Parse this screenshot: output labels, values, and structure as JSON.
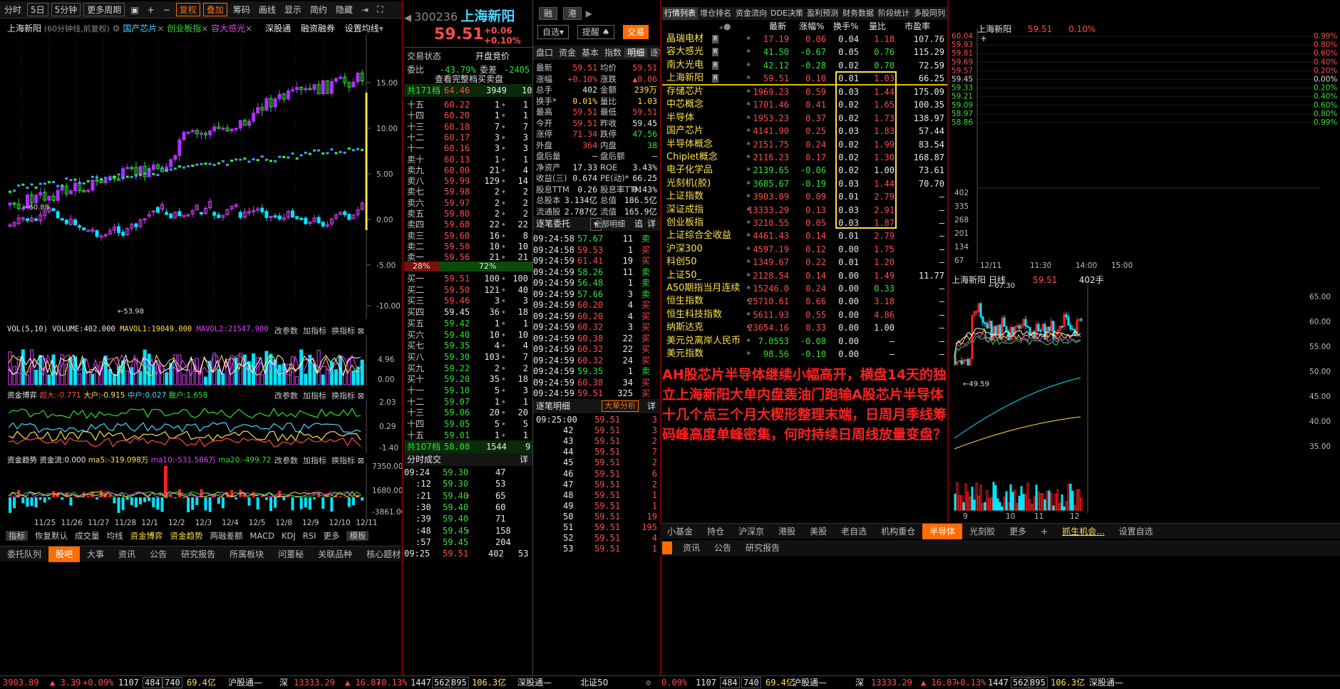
{
  "left_toolbar": [
    "分时",
    "5日",
    "5分钟",
    "更多周期",
    "复权",
    "叠加",
    "筹码",
    "画线",
    "显示",
    "简约",
    "隐藏"
  ],
  "chart_header": {
    "name": "上海新阳",
    "period": "(60分钟线,前复权)",
    "overlays": [
      "国产芯片",
      "创业板指",
      "容大感光"
    ],
    "links": [
      "深股通",
      "融资融券",
      "设置均线"
    ]
  },
  "price_axis": [
    "15.00",
    "10.00",
    "5.00",
    "0.00",
    "-5.00",
    "-10.00"
  ],
  "price_marks": {
    "high": "60.88",
    "low": "53.98"
  },
  "vol_header": {
    "label": "VOL(5,10)",
    "volume": "VOLUME:402.000",
    "mavol1": "MAVOL1:19049.000",
    "mavol2": "MAVOL2:21547.900",
    "buttons": [
      "改参数",
      "加指标",
      "换指标"
    ]
  },
  "vol_axis": [
    "4.96",
    "0.00"
  ],
  "fund_header": {
    "label": "资金博弈",
    "big": "超大:-0.771",
    "large": "大户:-0.915",
    "mid": "中户:0.027",
    "small": "散户:1.658",
    "buttons": [
      "改参数",
      "加指标",
      "换指标"
    ]
  },
  "fund_axis": [
    "2.03",
    "0.29",
    "-1.40"
  ],
  "trend_header": {
    "label": "资金趋势",
    "flow": "资金流:0.000",
    "ma5": "ma5:-319.098万",
    "ma10": "ma10:-531.586万",
    "ma20": "ma20:-499.72",
    "buttons": [
      "改参数",
      "加指标",
      "换指标"
    ]
  },
  "trend_axis": [
    "7350.00",
    "1680.00",
    "-3861.00"
  ],
  "dates": [
    "11/25",
    "11/26",
    "11/27",
    "11/28",
    "12/1",
    "12/2",
    "12/3",
    "12/4",
    "12/5",
    "12/8",
    "12/9",
    "12/10",
    "12/11"
  ],
  "indicator_tabs": [
    "指标",
    "恢复默认",
    "成交量",
    "均线",
    "资金博弈",
    "资金趋势",
    "两融差额",
    "MACD",
    "KDJ",
    "RSI",
    "更多",
    "模板"
  ],
  "left_bottom_tabs": [
    "委托队列",
    "股吧",
    "大事",
    "资讯",
    "公告",
    "研究报告",
    "所属板块",
    "问董秘",
    "关联品种",
    "核心题材"
  ],
  "quote": {
    "code": "300236",
    "name": "上海新阳",
    "price": "59.51",
    "chg": "+0.06",
    "pct": "+0.10%",
    "badges": [
      "融",
      "港"
    ],
    "buttons": [
      "自选",
      "提醒",
      "交易"
    ]
  },
  "book_header": {
    "status": "交易状态",
    "state": "开盘竞价",
    "wb_label": "委比",
    "wb": "-43.79%",
    "wc_label": "委差",
    "wc": "-2405",
    "full": "查看完整档买卖盘"
  },
  "sell_total": {
    "label": "共171档",
    "price": "64.46",
    "vol": "3949",
    "n": "10"
  },
  "sells": [
    [
      "十五",
      "60.22",
      "1",
      "1"
    ],
    [
      "十四",
      "60.20",
      "1",
      "1"
    ],
    [
      "十三",
      "60.18",
      "7",
      "7"
    ],
    [
      "十二",
      "60.17",
      "3",
      "3"
    ],
    [
      "十一",
      "60.16",
      "3",
      "3"
    ],
    [
      "卖十",
      "60.13",
      "1",
      "1"
    ],
    [
      "卖九",
      "60.00",
      "21",
      "4"
    ],
    [
      "卖八",
      "59.99",
      "129",
      "14"
    ],
    [
      "卖七",
      "59.98",
      "2",
      "2"
    ],
    [
      "卖六",
      "59.97",
      "2",
      "2"
    ],
    [
      "卖五",
      "59.80",
      "2",
      "2"
    ],
    [
      "卖四",
      "59.68",
      "22",
      "22"
    ],
    [
      "卖三",
      "59.60",
      "16",
      "8"
    ],
    [
      "卖二",
      "59.58",
      "10",
      "10"
    ],
    [
      "卖一",
      "59.56",
      "21",
      "21"
    ]
  ],
  "ratio": {
    "sell": "28%",
    "buy": "72%"
  },
  "buys": [
    [
      "买一",
      "59.51",
      "100",
      "100"
    ],
    [
      "买二",
      "59.50",
      "121",
      "40"
    ],
    [
      "买三",
      "59.46",
      "3",
      "3"
    ],
    [
      "买四",
      "59.45",
      "36",
      "18"
    ],
    [
      "买五",
      "59.42",
      "1",
      "1"
    ],
    [
      "买六",
      "59.40",
      "10",
      "10"
    ],
    [
      "买七",
      "59.35",
      "4",
      "4"
    ],
    [
      "买八",
      "59.30",
      "103",
      "7"
    ],
    [
      "买九",
      "59.22",
      "2",
      "2"
    ],
    [
      "买十",
      "59.20",
      "35",
      "18"
    ],
    [
      "十一",
      "59.10",
      "5",
      "3"
    ],
    [
      "十二",
      "59.07",
      "1",
      "1"
    ],
    [
      "十三",
      "59.06",
      "20",
      "20"
    ],
    [
      "十四",
      "59.05",
      "5",
      "5"
    ],
    [
      "十五",
      "59.01",
      "1",
      "1"
    ]
  ],
  "buy_total": {
    "label": "共107档",
    "price": "58.08",
    "vol": "1544",
    "n": "9"
  },
  "ticks_header": {
    "label": "分时成交",
    "btn": "详"
  },
  "ticks": [
    [
      "09:24",
      "59.30",
      "47",
      ""
    ],
    [
      ":12",
      "59.30",
      "53",
      ""
    ],
    [
      ":21",
      "59.40",
      "65",
      "↑"
    ],
    [
      ":30",
      "59.40",
      "60",
      ""
    ],
    [
      ":39",
      "59.40",
      "71",
      ""
    ],
    [
      ":48",
      "59.45",
      "158",
      "↑"
    ],
    [
      ":57",
      "59.45",
      "204",
      ""
    ],
    [
      "09:25",
      "59.51",
      "402",
      "53"
    ]
  ],
  "detail_tabs": [
    "盘口",
    "资金",
    "基本",
    "指数",
    "明细",
    "逐笔"
  ],
  "detail_rows": [
    [
      "最新",
      "59.51",
      "均价",
      "59.51"
    ],
    [
      "涨幅",
      "+0.10%",
      "涨跌",
      "▲0.06"
    ],
    [
      "总手",
      "402",
      "金额",
      "239万"
    ],
    [
      "换手*",
      "0.01%",
      "量比",
      "1.03"
    ],
    [
      "最高",
      "59.51",
      "最低",
      "59.51"
    ],
    [
      "今开",
      "59.51",
      "昨收",
      "59.45"
    ],
    [
      "涨停",
      "71.34",
      "跌停",
      "47.56"
    ],
    [
      "外盘",
      "364",
      "内盘",
      "38"
    ],
    [
      "盘后量",
      "—",
      "盘后额",
      "—"
    ],
    [
      "净资产",
      "17.33",
      "ROE",
      "3.43%"
    ],
    [
      "收益(三)",
      "0.674",
      "PE(动)*",
      "66.25"
    ],
    [
      "股息TTM",
      "0.26",
      "股息率TTM",
      "0.43%"
    ],
    [
      "总股本",
      "3.134亿",
      "总值",
      "186.5亿"
    ],
    [
      "流通股",
      "2.787亿",
      "流值",
      "165.9亿"
    ]
  ],
  "entrust_header": {
    "label": "逐笔委托",
    "mode": "全部明细",
    "b1": "追",
    "b2": "详"
  },
  "entrusts": [
    [
      "09:24:58",
      "57.67",
      "11",
      "卖"
    ],
    [
      "09:24:58",
      "59.53",
      "1",
      "买"
    ],
    [
      "09:24:59",
      "61.41",
      "19",
      "买"
    ],
    [
      "09:24:59",
      "58.26",
      "11",
      "卖"
    ],
    [
      "09:24:59",
      "56.48",
      "1",
      "卖"
    ],
    [
      "09:24:59",
      "57.66",
      "3",
      "卖"
    ],
    [
      "09:24:59",
      "60.20",
      "4",
      "买"
    ],
    [
      "09:24:59",
      "60.20",
      "4",
      "买"
    ],
    [
      "09:24:59",
      "60.32",
      "3",
      "买"
    ],
    [
      "09:24:59",
      "60.38",
      "22",
      "买"
    ],
    [
      "09:24:59",
      "60.32",
      "22",
      "买"
    ],
    [
      "09:24:59",
      "60.32",
      "24",
      "买"
    ],
    [
      "09:24:59",
      "59.35",
      "1",
      "卖"
    ],
    [
      "09:24:59",
      "60.38",
      "34",
      "买"
    ],
    [
      "09:24:59",
      "59.51",
      "325",
      "买"
    ]
  ],
  "trades_header": {
    "label": "逐笔明细",
    "btn": "大单分析",
    "b2": "详"
  },
  "trades": [
    [
      "09:25:00",
      "59.51",
      "3"
    ],
    [
      "42",
      "59.51",
      "3"
    ],
    [
      "43",
      "59.51",
      "2"
    ],
    [
      "44",
      "59.51",
      "7"
    ],
    [
      "45",
      "59.51",
      "2"
    ],
    [
      "46",
      "59.51",
      "6"
    ],
    [
      "47",
      "59.51",
      "2"
    ],
    [
      "48",
      "59.51",
      "1"
    ],
    [
      "49",
      "59.51",
      "1"
    ],
    [
      "50",
      "59.51",
      "19"
    ],
    [
      "51",
      "59.51",
      "195"
    ],
    [
      "52",
      "59.51",
      "4"
    ],
    [
      "53",
      "59.51",
      "1"
    ]
  ],
  "list_tabs": [
    "行情列表",
    "增仓排名",
    "资金流向",
    "DDE决策",
    "盈利预测",
    "财务数据",
    "阶段统计",
    "多股同列"
  ],
  "list_cols": [
    "最新",
    "涨幅%",
    "换手%",
    "量比",
    "市盈率"
  ],
  "stocks": [
    [
      "晶瑞电材",
      "17.19",
      "0.06",
      "0.04",
      "1.18",
      "107.76"
    ],
    [
      "容大感光",
      "41.50",
      "-0.67",
      "0.05",
      "0.76",
      "115.29"
    ],
    [
      "南大光电",
      "42.12",
      "-0.28",
      "0.02",
      "0.70",
      "72.59"
    ],
    [
      "上海新阳",
      "59.51",
      "0.10",
      "0.01",
      "1.03",
      "66.25"
    ]
  ],
  "indices": [
    [
      "存储芯片",
      "1969.23",
      "0.59",
      "0.03",
      "1.44",
      "175.09"
    ],
    [
      "中芯概念",
      "1701.46",
      "0.41",
      "0.02",
      "1.65",
      "100.35"
    ],
    [
      "半导体",
      "1953.23",
      "0.37",
      "0.02",
      "1.73",
      "138.97"
    ],
    [
      "国产芯片",
      "4141.90",
      "0.25",
      "0.03",
      "1.83",
      "57.44"
    ],
    [
      "半导体概念",
      "2151.75",
      "0.24",
      "0.02",
      "1.99",
      "83.54"
    ],
    [
      "Chiplet概念",
      "2116.23",
      "0.17",
      "0.02",
      "1.30",
      "168.87"
    ],
    [
      "电子化学品",
      "2139.65",
      "-0.06",
      "0.02",
      "1.00",
      "73.61"
    ],
    [
      "光刻机(胶)",
      "3685.67",
      "-0.19",
      "0.03",
      "1.44",
      "70.70"
    ],
    [
      "上证指数",
      "3903.89",
      "0.09",
      "0.01",
      "2.79",
      "—"
    ],
    [
      "深证成指",
      "13333.29",
      "0.13",
      "0.03",
      "2.91",
      "—"
    ],
    [
      "创业板指",
      "3210.55",
      "0.05",
      "0.03",
      "1.87",
      "—"
    ],
    [
      "上证综合全收益",
      "4461.43",
      "0.14",
      "0.01",
      "2.79",
      "—"
    ],
    [
      "沪深300",
      "4597.19",
      "0.12",
      "0.00",
      "1.75",
      "—"
    ],
    [
      "科创50",
      "1349.67",
      "0.22",
      "0.01",
      "1.20",
      "—"
    ],
    [
      "上证50_",
      "2128.54",
      "0.14",
      "0.00",
      "1.49",
      "11.77"
    ],
    [
      "A50期指当月连续",
      "15246.0",
      "0.24",
      "0.00",
      "0.33",
      "—"
    ],
    [
      "恒生指数",
      "25710.61",
      "0.66",
      "0.00",
      "3.18",
      "—"
    ],
    [
      "恒生科技指数",
      "5611.93",
      "0.55",
      "0.00",
      "4.86",
      "—"
    ],
    [
      "纳斯达克",
      "23654.16",
      "0.33",
      "0.00",
      "1.00",
      "—"
    ],
    [
      "美元兑离岸人民币",
      "7.0553",
      "-0.08",
      "0.00",
      "—",
      "—"
    ],
    [
      "美元指数",
      "98.56",
      "-0.10",
      "0.00",
      "—",
      "—"
    ]
  ],
  "note": "AH股芯片半导体继续小幅高开，横盘14天的独立上海新阳大单内盘轰油门跑输A股芯片半导体十几个点三个月大楔形整理末端，日周月季线筹码峰高度单峰密集，何时持续日周线放量变盘？",
  "sector_tabs": [
    "小基金",
    "持仓",
    "沪深京",
    "港股",
    "美股",
    "老自选",
    "机构重仓",
    "半导体",
    "光刻胶",
    "更多",
    "+",
    "抓生机会...",
    "设置自选"
  ],
  "news_tabs": [
    "资讯",
    "公告",
    "研究报告"
  ],
  "mini": {
    "name": "上海新阳",
    "price": "59.51",
    "pct": "0.10%",
    "axis": [
      "60.04",
      "59.93",
      "59.81",
      "59.69",
      "59.57",
      "59.45",
      "59.33",
      "59.21",
      "59.09",
      "58.97",
      "58.86"
    ],
    "right_axis": [
      "0.99%",
      "0.80%",
      "0.60%",
      "0.40%",
      "0.20%",
      "0.00%",
      "0.20%",
      "0.40%",
      "0.60%",
      "0.80%",
      "0.99%"
    ],
    "vol_axis": [
      "402",
      "335",
      "268",
      "201",
      "134",
      "67"
    ],
    "times": [
      "12/11",
      "11:30",
      "14:00",
      "15:00"
    ]
  },
  "daily": {
    "name": "上海新阳",
    "period": "日线",
    "price": "59.51",
    "vol": "402手",
    "high": "67.30",
    "low": "49.59",
    "axis": [
      "65.00",
      "60.00",
      "55.00",
      "50.00",
      "45.00",
      "40.00",
      "35.00"
    ],
    "months": [
      "9",
      "10",
      "11",
      "12"
    ]
  },
  "status": {
    "sh": "3903.89",
    "sh_chg": "▲ 3.39",
    "sh_pct": "+0.09%",
    "sh_v1": "1107",
    "sh_v2": "484",
    "sh_v3": "740",
    "sh_amt": "69.4亿",
    "hgt": "沪股通",
    "sz_label": "深",
    "sz": "13333.29",
    "sz_chg": "▲ 16.87",
    "sz_pct": "+0.13%",
    "sz_v1": "1447",
    "sz_v2": "562",
    "sz_v3": "895",
    "sz_amt": "106.3亿",
    "sgt": "深股通",
    "bz": "北证50",
    "r_pct": "0.09%",
    "r_v": "1107",
    "r_v2": "484",
    "r_v3": "740",
    "r_amt": "69.4亿",
    "r_hgt": "沪股通",
    "r_sz": "深",
    "r_szv": "13333.29",
    "r_szc": "▲ 16.87",
    "r_szp": "+0.13%",
    "r_a": "1447",
    "r_b": "562",
    "r_c": "895",
    "r_amt2": "106.3亿",
    "r_sgt": "深股通"
  }
}
